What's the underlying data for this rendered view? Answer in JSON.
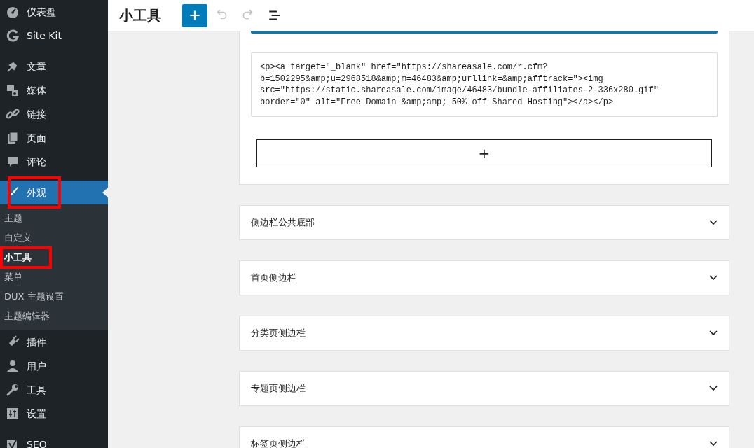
{
  "sidebar": {
    "items": [
      {
        "label": "仪表盘",
        "selected": false,
        "annotated": false
      },
      {
        "label": "Site Kit",
        "selected": false,
        "annotated": false
      },
      {
        "label": "文章",
        "selected": false,
        "annotated": false
      },
      {
        "label": "媒体",
        "selected": false,
        "annotated": false
      },
      {
        "label": "链接",
        "selected": false,
        "annotated": false
      },
      {
        "label": "页面",
        "selected": false,
        "annotated": false
      },
      {
        "label": "评论",
        "selected": false,
        "annotated": false
      },
      {
        "label": "外观",
        "selected": true,
        "annotated": true,
        "children": [
          {
            "label": "主题",
            "selected": false,
            "annotated": false
          },
          {
            "label": "自定义",
            "selected": false,
            "annotated": false
          },
          {
            "label": "小工具",
            "selected": true,
            "annotated": true
          },
          {
            "label": "菜单",
            "selected": false,
            "annotated": false
          },
          {
            "label": "DUX 主题设置",
            "selected": false,
            "annotated": false
          },
          {
            "label": "主题编辑器",
            "selected": false,
            "annotated": false
          }
        ]
      },
      {
        "label": "插件",
        "selected": false,
        "annotated": false
      },
      {
        "label": "用户",
        "selected": false,
        "annotated": false
      },
      {
        "label": "工具",
        "selected": false,
        "annotated": false
      },
      {
        "label": "设置",
        "selected": false,
        "annotated": false
      },
      {
        "label": "SEO",
        "selected": false,
        "annotated": false
      }
    ]
  },
  "header": {
    "title": "小工具",
    "tools": [
      {
        "kind": "add",
        "disabled": false
      },
      {
        "kind": "undo",
        "disabled": true
      },
      {
        "kind": "redo",
        "disabled": true
      },
      {
        "kind": "list-view",
        "disabled": false
      }
    ]
  },
  "widget_areas": [
    {
      "expanded": true,
      "blocks": [
        {
          "kind": "html",
          "code": "<p><a target=\"_blank\" href=\"https://shareasale.com/r.cfm?\nb=1502295&amp;u=2968518&amp;m=46483&amp;urllink=&amp;afftrack=\"><img\nsrc=\"https://static.shareasale.com/image/46483/bundle-affiliates-2-336x280.gif\"\nborder=\"0\" alt=\"Free Domain &amp;amp; 50% off Shared Hosting\"></a></p>"
        }
      ],
      "add_label": "+"
    },
    {
      "title": "侧边栏公共底部",
      "expanded": false
    },
    {
      "title": "首页侧边栏",
      "expanded": false
    },
    {
      "title": "分类页侧边栏",
      "expanded": false
    },
    {
      "title": "专题页侧边栏",
      "expanded": false
    },
    {
      "title": "标签页侧边栏",
      "expanded": false
    }
  ]
}
